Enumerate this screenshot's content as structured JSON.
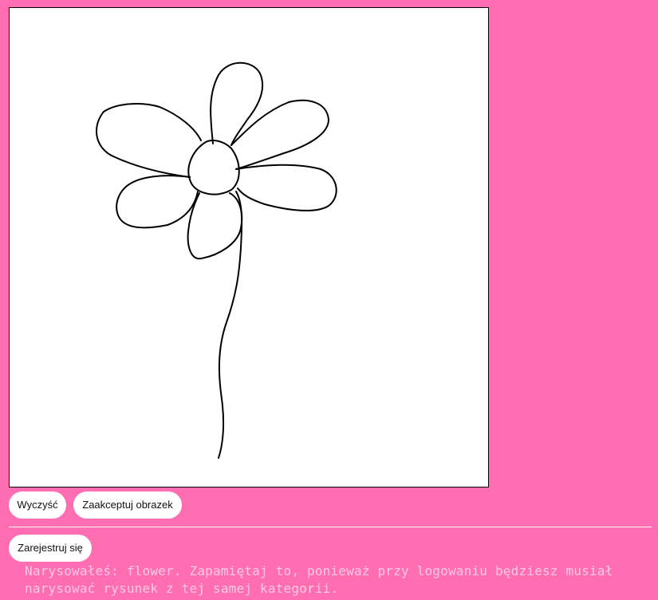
{
  "canvas": {
    "background": "#ffffff",
    "stroke_color": "#000000",
    "drawing_subject": "flower"
  },
  "buttons": {
    "clear_label": "Wyczyść",
    "accept_label": "Zaakceptuj obrazek",
    "register_label": "Zarejestruj się"
  },
  "message": {
    "text": "Narysowałeś: flower. Zapamiętaj to, ponieważ przy logowaniu będziesz musiał narysować rysunek z tej samej kategorii."
  },
  "colors": {
    "page_background": "#ff6eb2",
    "message_text": "#ffc8e3",
    "button_background": "#ffffff"
  }
}
